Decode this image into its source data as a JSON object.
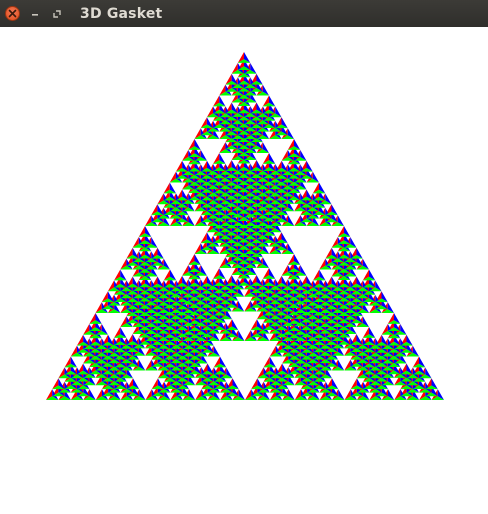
{
  "window": {
    "title": "3D Gasket"
  },
  "titlebar": {
    "close_icon": "close-icon",
    "minimize_icon": "minimize-icon",
    "maximize_icon": "maximize-icon"
  },
  "gasket": {
    "colors": {
      "left_face": "#ff0000",
      "right_face": "#0000ff",
      "bottom_face": "#00ff00",
      "background": "#ffffff"
    }
  }
}
